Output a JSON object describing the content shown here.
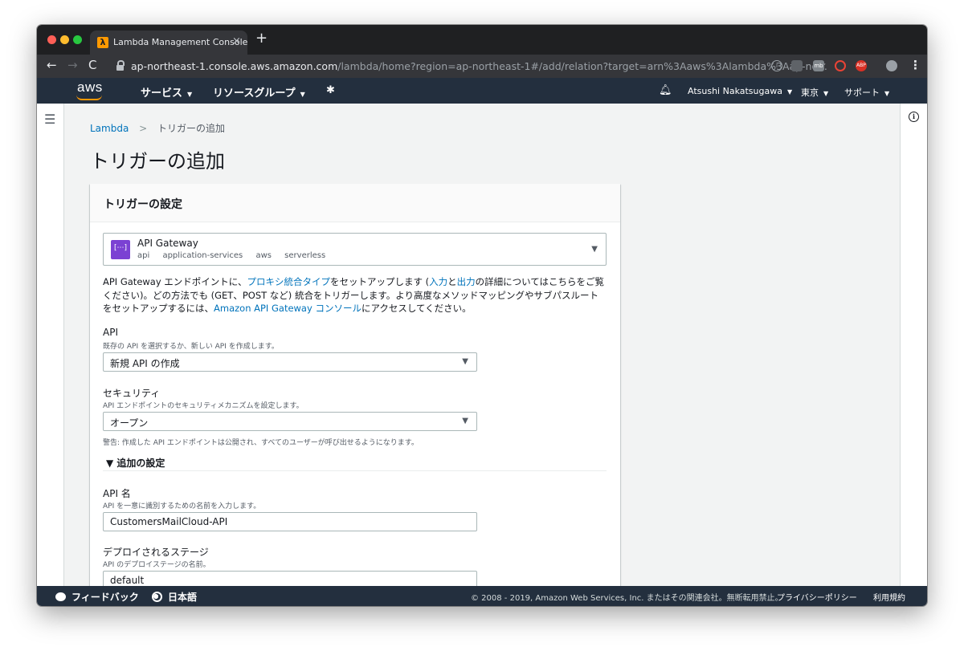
{
  "browser": {
    "tab_title": "Lambda Management Console",
    "tab_close": "×",
    "new_tab": "+",
    "url_host": "ap-northeast-1.console.aws.amazon.com",
    "url_path": "/lambda/home?region=ap-northeast-1#/add/relation?target=arn%3Aaws%3Alambda%3Aap-no...",
    "extensions": [
      "info-icon",
      "hat-icon",
      "mb-icon",
      "block-icon",
      "abp-icon",
      "avatar-icon"
    ]
  },
  "aws_nav": {
    "logo": "aws",
    "services": "サービス",
    "resource_groups": "リソースグループ",
    "user": "Atsushi Nakatsugawa",
    "region": "東京",
    "support": "サポート"
  },
  "breadcrumb": {
    "root": "Lambda",
    "separator": ">",
    "current": "トリガーの追加"
  },
  "page": {
    "title": "トリガーの追加",
    "panel_title": "トリガーの設定"
  },
  "trigger": {
    "name": "API Gateway",
    "tags": [
      "api",
      "application-services",
      "aws",
      "serverless"
    ]
  },
  "description": {
    "t1": "API Gateway エンドポイントに、",
    "l1": "プロキシ統合タイプ",
    "t2": "をセットアップします (",
    "l2": "入力",
    "t3": "と",
    "l3": "出力",
    "t4": "の詳細についてはこちらをご覧ください)。どの方法でも (GET、POST など) 統合をトリガーします。より高度なメソッドマッピングやサブパスルートをセットアップするには、",
    "l4": "Amazon API Gateway コンソール",
    "t5": "にアクセスしてください。"
  },
  "api_field": {
    "label": "API",
    "help": "既存の API を選択するか、新しい API を作成します。",
    "value": "新規 API の作成"
  },
  "security_field": {
    "label": "セキュリティ",
    "help": "API エンドポイントのセキュリティメカニズムを設定します。",
    "value": "オープン",
    "warning": "警告: 作成した API エンドポイントは公開され、すべてのユーザーが呼び出せるようになります。"
  },
  "advanced": {
    "toggle": "▼ 追加の設定"
  },
  "api_name_field": {
    "label": "API 名",
    "help": "API を一意に識別するための名前を入力します。",
    "value": "CustomersMailCloud-API"
  },
  "stage_field": {
    "label": "デプロイされるステージ",
    "help": "API のデプロイステージの名前。",
    "value": "default"
  },
  "footer": {
    "feedback": "フィードバック",
    "language": "日本語",
    "copyright": "© 2008 - 2019, Amazon Web Services, Inc. またはその関連会社。無断転用禁止。",
    "privacy": "プライバシーポリシー",
    "terms": "利用規約"
  },
  "colors": {
    "aws_nav": "#232f3e",
    "aws_orange": "#ff9900",
    "link": "#0073bb",
    "apigw_icon": "#7b41d3"
  }
}
